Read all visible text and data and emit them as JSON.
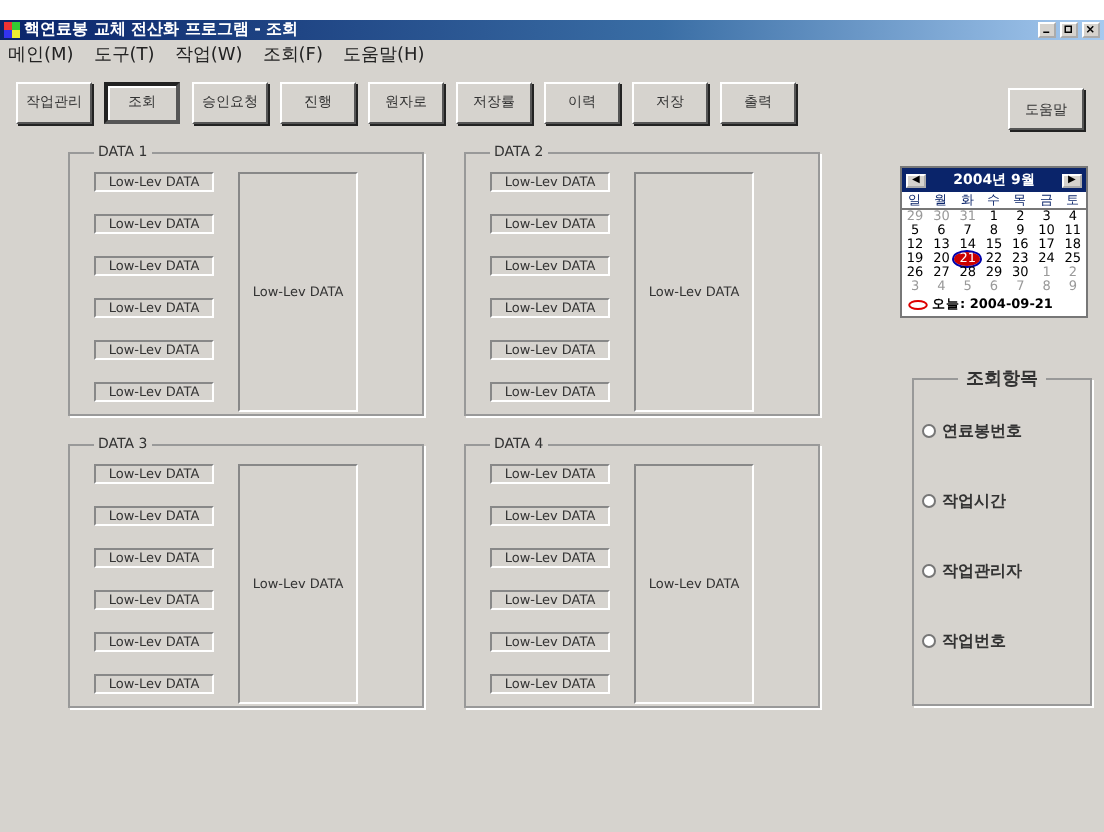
{
  "window": {
    "title": "핵연료봉 교체 전산화 프로그램 - 조회"
  },
  "menu": [
    "메인(M)",
    "도구(T)",
    "작업(W)",
    "조회(F)",
    "도움말(H)"
  ],
  "toolbar": [
    {
      "label": "작업관리",
      "selected": false
    },
    {
      "label": "조회",
      "selected": true
    },
    {
      "label": "승인요청",
      "selected": false
    },
    {
      "label": "진행",
      "selected": false
    },
    {
      "label": "원자로",
      "selected": false
    },
    {
      "label": "저장률",
      "selected": false
    },
    {
      "label": "이력",
      "selected": false
    },
    {
      "label": "저장",
      "selected": false
    },
    {
      "label": "출력",
      "selected": false
    }
  ],
  "help_button": "도움말",
  "panels": [
    {
      "title": "DATA 1",
      "fields": [
        "Low-Lev DATA",
        "Low-Lev DATA",
        "Low-Lev DATA",
        "Low-Lev DATA",
        "Low-Lev DATA",
        "Low-Lev DATA"
      ],
      "main": "Low-Lev DATA"
    },
    {
      "title": "DATA 2",
      "fields": [
        "Low-Lev DATA",
        "Low-Lev DATA",
        "Low-Lev DATA",
        "Low-Lev DATA",
        "Low-Lev DATA",
        "Low-Lev DATA"
      ],
      "main": "Low-Lev DATA"
    },
    {
      "title": "DATA 3",
      "fields": [
        "Low-Lev DATA",
        "Low-Lev DATA",
        "Low-Lev DATA",
        "Low-Lev DATA",
        "Low-Lev DATA",
        "Low-Lev DATA"
      ],
      "main": "Low-Lev DATA"
    },
    {
      "title": "DATA 4",
      "fields": [
        "Low-Lev DATA",
        "Low-Lev DATA",
        "Low-Lev DATA",
        "Low-Lev DATA",
        "Low-Lev DATA",
        "Low-Lev DATA"
      ],
      "main": "Low-Lev DATA"
    }
  ],
  "calendar": {
    "prev": "◀",
    "next": "▶",
    "month": "2004년 9월",
    "weekdays": [
      "일",
      "월",
      "화",
      "수",
      "목",
      "금",
      "토"
    ],
    "weeks": [
      [
        {
          "day": "29",
          "muted": true,
          "selected": false
        },
        {
          "day": "30",
          "muted": true,
          "selected": false
        },
        {
          "day": "31",
          "muted": true,
          "selected": false
        },
        {
          "day": "1",
          "muted": false,
          "selected": false
        },
        {
          "day": "2",
          "muted": false,
          "selected": false
        },
        {
          "day": "3",
          "muted": false,
          "selected": false
        },
        {
          "day": "4",
          "muted": false,
          "selected": false
        }
      ],
      [
        {
          "day": "5",
          "muted": false,
          "selected": false
        },
        {
          "day": "6",
          "muted": false,
          "selected": false
        },
        {
          "day": "7",
          "muted": false,
          "selected": false
        },
        {
          "day": "8",
          "muted": false,
          "selected": false
        },
        {
          "day": "9",
          "muted": false,
          "selected": false
        },
        {
          "day": "10",
          "muted": false,
          "selected": false
        },
        {
          "day": "11",
          "muted": false,
          "selected": false
        }
      ],
      [
        {
          "day": "12",
          "muted": false,
          "selected": false
        },
        {
          "day": "13",
          "muted": false,
          "selected": false
        },
        {
          "day": "14",
          "muted": false,
          "selected": false
        },
        {
          "day": "15",
          "muted": false,
          "selected": false
        },
        {
          "day": "16",
          "muted": false,
          "selected": false
        },
        {
          "day": "17",
          "muted": false,
          "selected": false
        },
        {
          "day": "18",
          "muted": false,
          "selected": false
        }
      ],
      [
        {
          "day": "19",
          "muted": false,
          "selected": false
        },
        {
          "day": "20",
          "muted": false,
          "selected": false
        },
        {
          "day": "21",
          "muted": false,
          "selected": true
        },
        {
          "day": "22",
          "muted": false,
          "selected": false
        },
        {
          "day": "23",
          "muted": false,
          "selected": false
        },
        {
          "day": "24",
          "muted": false,
          "selected": false
        },
        {
          "day": "25",
          "muted": false,
          "selected": false
        }
      ],
      [
        {
          "day": "26",
          "muted": false,
          "selected": false
        },
        {
          "day": "27",
          "muted": false,
          "selected": false
        },
        {
          "day": "28",
          "muted": false,
          "selected": false
        },
        {
          "day": "29",
          "muted": false,
          "selected": false
        },
        {
          "day": "30",
          "muted": false,
          "selected": false
        },
        {
          "day": "1",
          "muted": true,
          "selected": false
        },
        {
          "day": "2",
          "muted": true,
          "selected": false
        }
      ],
      [
        {
          "day": "3",
          "muted": true,
          "selected": false
        },
        {
          "day": "4",
          "muted": true,
          "selected": false
        },
        {
          "day": "5",
          "muted": true,
          "selected": false
        },
        {
          "day": "6",
          "muted": true,
          "selected": false
        },
        {
          "day": "7",
          "muted": true,
          "selected": false
        },
        {
          "day": "8",
          "muted": true,
          "selected": false
        },
        {
          "day": "9",
          "muted": true,
          "selected": false
        }
      ]
    ],
    "today": "오늘: 2004-09-21"
  },
  "query_group": {
    "title": "조회항목",
    "options": [
      {
        "label": "연료봉번호",
        "selected": false
      },
      {
        "label": "작업시간",
        "selected": false
      },
      {
        "label": "작업관리자",
        "selected": false
      },
      {
        "label": "작업번호",
        "selected": false
      }
    ]
  }
}
